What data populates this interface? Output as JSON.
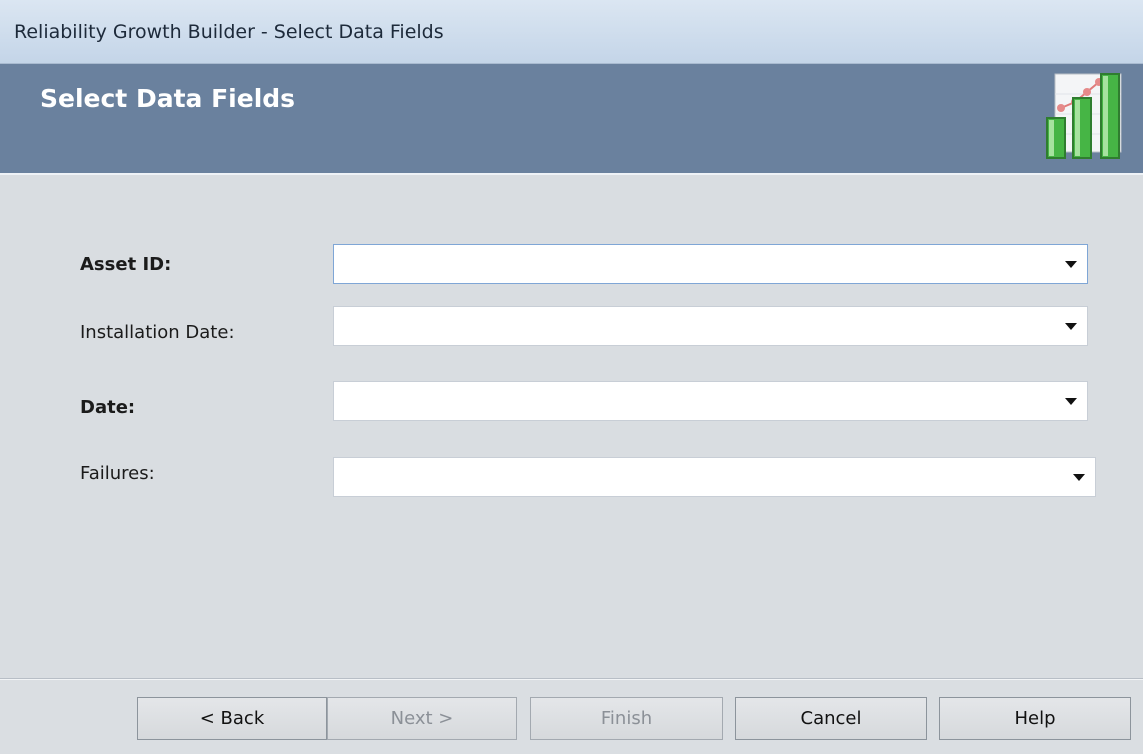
{
  "window": {
    "title": "Reliability Growth Builder - Select Data Fields"
  },
  "header": {
    "title": "Select Data Fields",
    "icon": "reliability-growth-chart-icon"
  },
  "fields": [
    {
      "label": "Asset ID:",
      "value": "",
      "required": true
    },
    {
      "label": "Installation Date:",
      "value": "",
      "required": false
    },
    {
      "label": "Date:",
      "value": "",
      "required": true
    },
    {
      "label": "Failures:",
      "value": "",
      "required": false
    }
  ],
  "buttons": {
    "back": "< Back",
    "next": "Next >",
    "finish": "Finish",
    "cancel": "Cancel",
    "help": "Help"
  },
  "colors": {
    "header_band": "#6a819e",
    "content_bg": "#d9dde1",
    "icon_green": "#46b545"
  }
}
